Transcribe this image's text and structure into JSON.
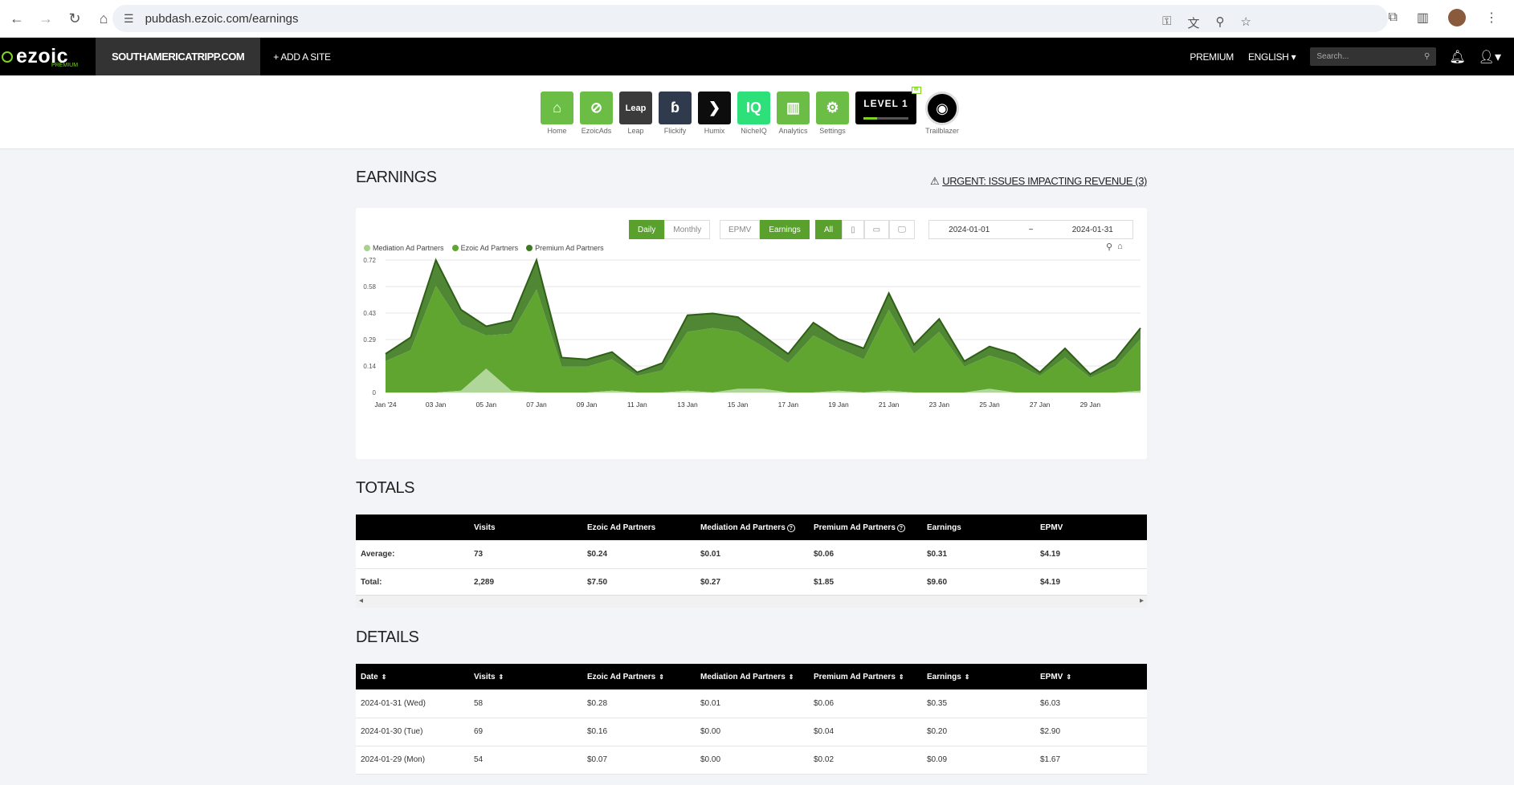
{
  "browser": {
    "url": "pubdash.ezoic.com/earnings"
  },
  "topnav": {
    "logo": "ezoic",
    "logo_sub": "PREMIUM",
    "site": "SOUTHAMERICATRIPP.COM",
    "add_site": "+ ADD A SITE",
    "premium": "PREMIUM",
    "language": "ENGLISH",
    "search_placeholder": "Search..."
  },
  "apps": [
    {
      "label": "Home",
      "color": "#6cbd45",
      "icon": "home-icon",
      "glyph": "⌂"
    },
    {
      "label": "EzoicAds",
      "color": "#6cbd45",
      "icon": "ezoicads-icon",
      "glyph": "⊘"
    },
    {
      "label": "Leap",
      "color": "#3b3b3b",
      "icon": "leap-icon",
      "glyph": "Leap"
    },
    {
      "label": "Flickify",
      "color": "#2f3b4c",
      "icon": "flickify-icon",
      "glyph": "ɓ"
    },
    {
      "label": "Humix",
      "color": "#0d0d0d",
      "icon": "humix-icon",
      "glyph": "❯"
    },
    {
      "label": "NicheIQ",
      "color": "#2de07a",
      "icon": "nicheiq-icon",
      "glyph": "IQ"
    },
    {
      "label": "Analytics",
      "color": "#6cbd45",
      "icon": "analytics-icon",
      "glyph": "▥"
    },
    {
      "label": "Settings",
      "color": "#6cbd45",
      "icon": "settings-icon",
      "glyph": "⚙"
    }
  ],
  "level_badge": "LEVEL 1",
  "trailblazer": "Trailblazer",
  "earnings": {
    "title": "EARNINGS",
    "urgent": "URGENT: ISSUES IMPACTING REVENUE (3)",
    "controls": {
      "daily": "Daily",
      "monthly": "Monthly",
      "epmv": "EPMV",
      "earnings": "Earnings",
      "all": "All",
      "date_from": "2024-01-01",
      "date_sep": "~",
      "date_to": "2024-01-31"
    },
    "legend": [
      "Mediation Ad Partners",
      "Ezoic Ad Partners",
      "Premium Ad Partners"
    ]
  },
  "chart_data": {
    "type": "area",
    "stacked": true,
    "x": [
      "2024-01-01",
      "2024-01-02",
      "2024-01-03",
      "2024-01-04",
      "2024-01-05",
      "2024-01-06",
      "2024-01-07",
      "2024-01-08",
      "2024-01-09",
      "2024-01-10",
      "2024-01-11",
      "2024-01-12",
      "2024-01-13",
      "2024-01-14",
      "2024-01-15",
      "2024-01-16",
      "2024-01-17",
      "2024-01-18",
      "2024-01-19",
      "2024-01-20",
      "2024-01-21",
      "2024-01-22",
      "2024-01-23",
      "2024-01-24",
      "2024-01-25",
      "2024-01-26",
      "2024-01-27",
      "2024-01-28",
      "2024-01-29",
      "2024-01-30",
      "2024-01-31"
    ],
    "x_tick_labels": [
      "Jan '24",
      "03 Jan",
      "05 Jan",
      "07 Jan",
      "09 Jan",
      "11 Jan",
      "13 Jan",
      "15 Jan",
      "17 Jan",
      "19 Jan",
      "21 Jan",
      "23 Jan",
      "25 Jan",
      "27 Jan",
      "29 Jan"
    ],
    "y_ticks": [
      "0",
      "0.14",
      "0.29",
      "0.43",
      "0.58",
      "0.72"
    ],
    "ylim": [
      0,
      0.72
    ],
    "series": [
      {
        "name": "Mediation Ad Partners",
        "color": "#a9d18e",
        "values": [
          0.0,
          0.0,
          0.0,
          0.01,
          0.13,
          0.01,
          0.0,
          0.0,
          0.0,
          0.01,
          0.0,
          0.0,
          0.01,
          0.0,
          0.02,
          0.02,
          0.0,
          0.0,
          0.01,
          0.0,
          0.01,
          0.0,
          0.0,
          0.0,
          0.02,
          0.0,
          0.0,
          0.0,
          0.0,
          0.0,
          0.01
        ]
      },
      {
        "name": "Ezoic Ad Partners",
        "color": "#5fa52f",
        "values": [
          0.17,
          0.23,
          0.58,
          0.36,
          0.18,
          0.31,
          0.56,
          0.14,
          0.14,
          0.17,
          0.09,
          0.12,
          0.32,
          0.35,
          0.31,
          0.23,
          0.16,
          0.31,
          0.23,
          0.18,
          0.44,
          0.21,
          0.33,
          0.14,
          0.18,
          0.16,
          0.09,
          0.19,
          0.08,
          0.14,
          0.28
        ]
      },
      {
        "name": "Premium Ad Partners",
        "color": "#3d7a1f",
        "values": [
          0.04,
          0.07,
          0.14,
          0.08,
          0.05,
          0.07,
          0.16,
          0.05,
          0.04,
          0.04,
          0.02,
          0.04,
          0.09,
          0.08,
          0.08,
          0.06,
          0.05,
          0.07,
          0.05,
          0.06,
          0.09,
          0.05,
          0.07,
          0.03,
          0.05,
          0.05,
          0.02,
          0.05,
          0.02,
          0.04,
          0.06
        ]
      }
    ]
  },
  "totals": {
    "title": "TOTALS",
    "headers": [
      "",
      "Visits",
      "Ezoic Ad Partners",
      "Mediation Ad Partners",
      "Premium Ad Partners",
      "Earnings",
      "EPMV"
    ],
    "rows": [
      [
        "Average:",
        "73",
        "$0.24",
        "$0.01",
        "$0.06",
        "$0.31",
        "$4.19"
      ],
      [
        "Total:",
        "2,289",
        "$7.50",
        "$0.27",
        "$1.85",
        "$9.60",
        "$4.19"
      ]
    ]
  },
  "details": {
    "title": "DETAILS",
    "headers": [
      "Date",
      "Visits",
      "Ezoic Ad Partners",
      "Mediation Ad Partners",
      "Premium Ad Partners",
      "Earnings",
      "EPMV"
    ],
    "rows": [
      [
        "2024-01-31 (Wed)",
        "58",
        "$0.28",
        "$0.01",
        "$0.06",
        "$0.35",
        "$6.03"
      ],
      [
        "2024-01-30 (Tue)",
        "69",
        "$0.16",
        "$0.00",
        "$0.04",
        "$0.20",
        "$2.90"
      ],
      [
        "2024-01-29 (Mon)",
        "54",
        "$0.07",
        "$0.00",
        "$0.02",
        "$0.09",
        "$1.67"
      ]
    ]
  }
}
